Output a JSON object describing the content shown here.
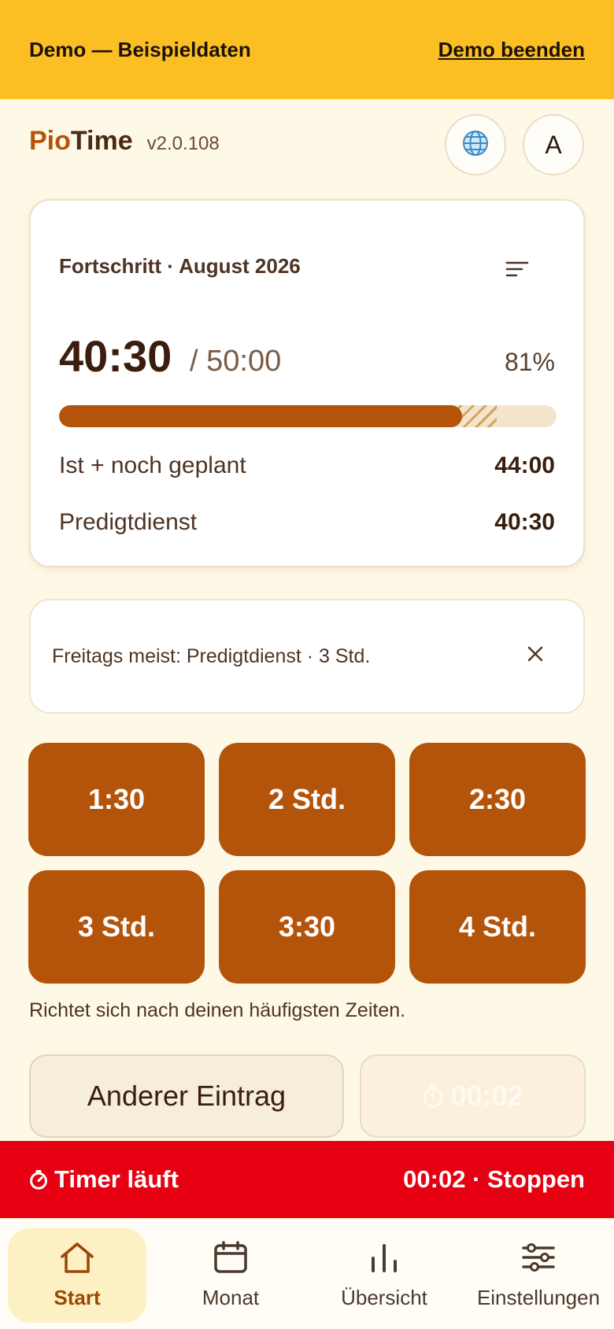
{
  "banner": {
    "title": "Demo — Beispieldaten",
    "exit_label": "Demo beenden"
  },
  "header": {
    "brand_part1": "Pio",
    "brand_part2": "Time",
    "version": "v2.0.108",
    "avatar_letter": "A"
  },
  "progress": {
    "heading": "Fortschritt · August 2026",
    "actual": "40:30",
    "target": "/ 50:00",
    "percent": "81%",
    "fill_fraction": 0.81,
    "planned_fraction": 0.88,
    "rows": [
      {
        "label": "Ist + noch geplant",
        "value": "44:00"
      },
      {
        "label": "Predigtdienst",
        "value": "40:30"
      }
    ]
  },
  "suggestion": {
    "text": "Freitags meist: Predigtdienst · 3 Std."
  },
  "quick_buttons": [
    "1:30",
    "2 Std.",
    "2:30",
    "3 Std.",
    "3:30",
    "4 Std."
  ],
  "quick_hint": "Richtet sich nach deinen häufigsten Zeiten.",
  "actions": {
    "other_label": "Anderer Eintrag",
    "timer_value": "00:02"
  },
  "timer_bar": {
    "status": "Timer läuft",
    "action": "00:02 · Stoppen"
  },
  "nav": [
    {
      "label": "Start",
      "icon": "home-icon",
      "active": true
    },
    {
      "label": "Monat",
      "icon": "calendar-icon",
      "active": false
    },
    {
      "label": "Übersicht",
      "icon": "bar-chart-icon",
      "active": false
    },
    {
      "label": "Einstellungen",
      "icon": "sliders-icon",
      "active": false
    }
  ],
  "colors": {
    "accent": "#b4540b",
    "banner": "#fbbf24",
    "timer_bar": "#e60012",
    "background": "#fef9e7"
  }
}
